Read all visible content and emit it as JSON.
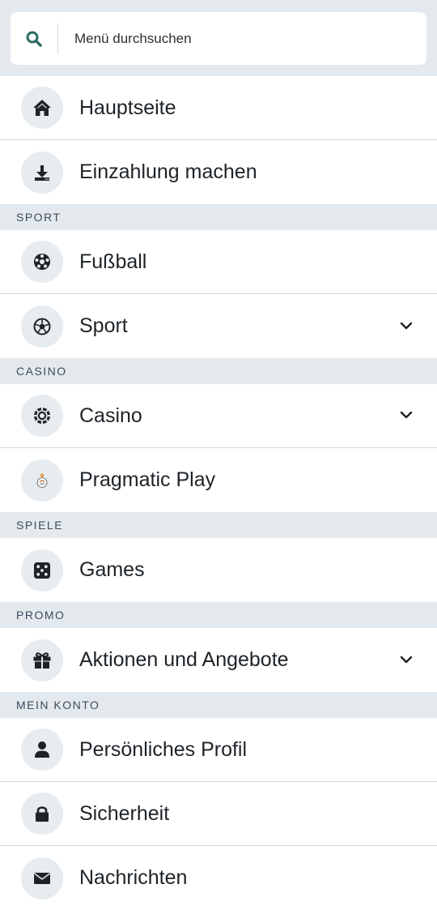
{
  "search": {
    "placeholder": "Menü durchsuchen"
  },
  "items": {
    "home": {
      "label": "Hauptseite",
      "icon": "home-icon"
    },
    "deposit": {
      "label": "Einzahlung machen",
      "icon": "download-icon"
    },
    "football": {
      "label": "Fußball",
      "icon": "football-icon"
    },
    "sport": {
      "label": "Sport",
      "icon": "soccer-ball-icon"
    },
    "casino": {
      "label": "Casino",
      "icon": "casino-chip-icon"
    },
    "pragmatic": {
      "label": "Pragmatic Play",
      "icon": "pragmatic-play-icon"
    },
    "games": {
      "label": "Games",
      "icon": "dice-icon"
    },
    "promotions": {
      "label": "Aktionen und Angebote",
      "icon": "gift-icon"
    },
    "profile": {
      "label": "Persönliches Profil",
      "icon": "user-icon"
    },
    "security": {
      "label": "Sicherheit",
      "icon": "lock-icon"
    },
    "messages": {
      "label": "Nachrichten",
      "icon": "envelope-icon"
    }
  },
  "sections": {
    "sport": "SPORT",
    "casino": "CASINO",
    "games": "SPIELE",
    "promo": "PROMO",
    "account": "MEIN KONTO"
  },
  "colors": {
    "section_bg": "#e4e9ee",
    "icon_bg": "#e6ecef",
    "accent": "#2f6d62",
    "divider": "#c7dbd6"
  }
}
